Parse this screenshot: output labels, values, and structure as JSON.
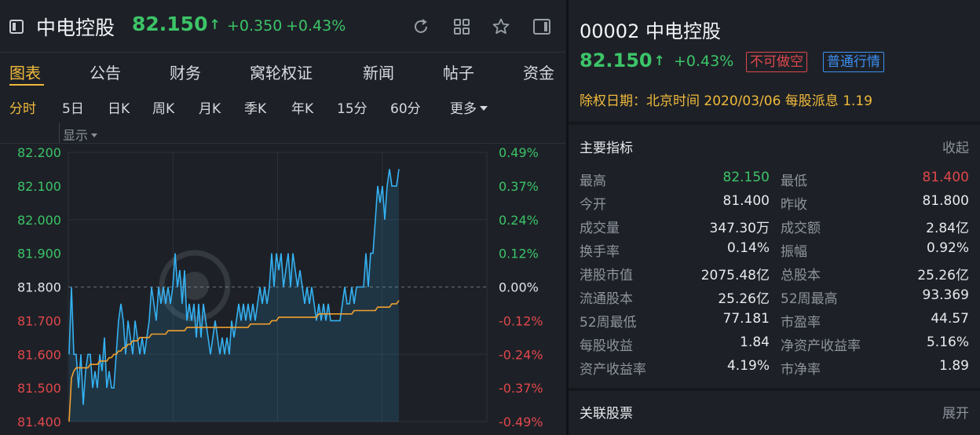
{
  "header": {
    "name": "中电控股",
    "price": "82.150",
    "price_arrow": "↑",
    "change": "+0.350",
    "change_pct": "+0.43%",
    "icons": [
      "panel-toggle-icon",
      "refresh-icon",
      "grid-icon",
      "star-icon",
      "sidebar-toggle-icon"
    ]
  },
  "tabs": [
    "图表",
    "公告",
    "财务",
    "窝轮权证",
    "新闻",
    "帖子",
    "资金"
  ],
  "active_tab": "图表",
  "periods": [
    "分时",
    "5日",
    "日K",
    "周K",
    "月K",
    "季K",
    "年K",
    "15分",
    "60分",
    "更多"
  ],
  "active_period": "分时",
  "display_label": "显示",
  "colors": {
    "up": "#3cc468",
    "down": "#e0474c",
    "accent": "#f0b93b",
    "price_line": "#35b1f2",
    "avg_line": "#f0a030",
    "badge_blue": "#3d8ef0"
  },
  "chart_data": {
    "type": "line",
    "prev_close": 81.8,
    "ylim": [
      81.4,
      82.2
    ],
    "y_ticks": [
      "82.200",
      "82.100",
      "82.000",
      "81.900",
      "81.800",
      "81.700",
      "81.600",
      "81.500",
      "81.400"
    ],
    "pct_ticks": [
      "0.49%",
      "0.37%",
      "0.24%",
      "0.12%",
      "0.00%",
      "-0.12%",
      "-0.24%",
      "-0.37%",
      "-0.49%"
    ],
    "series": [
      {
        "values": [
          81.6,
          81.8,
          81.6,
          81.6,
          81.5,
          81.6,
          81.45,
          81.55,
          81.6,
          81.6,
          81.5,
          81.55,
          81.5,
          81.6,
          81.55,
          81.65,
          81.5,
          81.55,
          81.5,
          81.5,
          81.6,
          81.7,
          81.75,
          81.7,
          81.6,
          81.7,
          81.65,
          81.6,
          81.7,
          81.65,
          81.6,
          81.65,
          81.6,
          81.65,
          81.7,
          81.8,
          81.75,
          81.7,
          81.8,
          81.75,
          81.8,
          81.75,
          81.8,
          81.75,
          81.8,
          81.9,
          81.8,
          81.85,
          81.75,
          81.85,
          81.7,
          81.75,
          81.7,
          81.75,
          81.65,
          81.75,
          81.65,
          81.75,
          81.7,
          81.65,
          81.6,
          81.65,
          81.7,
          81.65,
          81.6,
          81.65,
          81.6,
          81.65,
          81.6,
          81.7,
          81.65,
          81.7,
          81.75,
          81.7,
          81.75,
          81.7,
          81.75,
          81.7,
          81.75,
          81.7,
          81.75,
          81.8,
          81.75,
          81.8,
          81.75,
          81.8,
          81.9,
          81.8,
          81.9,
          81.85,
          81.9,
          81.8,
          81.85,
          81.9,
          81.8,
          81.9,
          81.85,
          81.8,
          81.85,
          81.8,
          81.75,
          81.8,
          81.75,
          81.8,
          81.75,
          81.7,
          81.75,
          81.7,
          81.75,
          81.7,
          81.75,
          81.7,
          81.7,
          81.7,
          81.7,
          81.7,
          81.75,
          81.8,
          81.75,
          81.75,
          81.8,
          81.75,
          81.8,
          81.8,
          81.8,
          81.8,
          81.9,
          81.8,
          81.9,
          81.9,
          82.0,
          82.1,
          82.05,
          82.1,
          82.0,
          82.1,
          82.15,
          82.1,
          82.1,
          82.1,
          82.15
        ]
      },
      {
        "values": [
          81.4,
          81.53,
          81.55,
          81.56,
          81.56,
          81.56,
          81.56,
          81.56,
          81.56,
          81.57,
          81.57,
          81.57,
          81.57,
          81.58,
          81.58,
          81.58,
          81.58,
          81.59,
          81.59,
          81.6,
          81.6,
          81.61,
          81.61,
          81.62,
          81.62,
          81.63,
          81.63,
          81.64,
          81.64,
          81.64,
          81.65,
          81.65,
          81.65,
          81.65,
          81.65,
          81.66,
          81.66,
          81.66,
          81.66,
          81.66,
          81.66,
          81.66,
          81.67,
          81.67,
          81.67,
          81.67,
          81.67,
          81.67,
          81.67,
          81.67,
          81.68,
          81.68,
          81.68,
          81.68,
          81.68,
          81.68,
          81.68,
          81.68,
          81.68,
          81.68,
          81.68,
          81.68,
          81.68,
          81.68,
          81.68,
          81.68,
          81.68,
          81.68,
          81.68,
          81.68,
          81.68,
          81.68,
          81.68,
          81.68,
          81.68,
          81.68,
          81.68,
          81.69,
          81.69,
          81.69,
          81.69,
          81.69,
          81.69,
          81.69,
          81.69,
          81.69,
          81.7,
          81.7,
          81.7,
          81.71,
          81.71,
          81.71,
          81.71,
          81.71,
          81.71,
          81.71,
          81.71,
          81.71,
          81.71,
          81.71,
          81.71,
          81.71,
          81.71,
          81.71,
          81.71,
          81.71,
          81.72,
          81.72,
          81.72,
          81.72,
          81.72,
          81.72,
          81.72,
          81.72,
          81.72,
          81.72,
          81.72,
          81.72,
          81.72,
          81.72,
          81.72,
          81.73,
          81.73,
          81.73,
          81.73,
          81.73,
          81.73,
          81.73,
          81.73,
          81.73,
          81.73,
          81.74,
          81.74,
          81.74,
          81.74,
          81.74,
          81.74,
          81.75,
          81.75,
          81.75,
          81.76
        ]
      }
    ],
    "grid": true
  },
  "quote": {
    "code": "00002",
    "name": "中电控股",
    "price": "82.150",
    "price_arrow": "↑",
    "change_pct": "+0.43%",
    "badge_short": "不可做空",
    "badge_quote": "普通行情",
    "ex_dividend": "除权日期：北京时间 2020/03/06 每股派息 1.19"
  },
  "indicators": {
    "title": "主要指标",
    "collapse_label": "收起",
    "rows": [
      {
        "l1": "最高",
        "v1": "82.150",
        "l2": "最低",
        "v2": "81.400"
      },
      {
        "l1": "今开",
        "v1": "81.400",
        "l2": "昨收",
        "v2": "81.800"
      },
      {
        "l1": "成交量",
        "v1": "347.30万",
        "l2": "成交额",
        "v2": "2.84亿"
      },
      {
        "l1": "换手率",
        "v1": "0.14%",
        "l2": "振幅",
        "v2": "0.92%"
      },
      {
        "l1": "港股市值",
        "v1": "2075.48亿",
        "l2": "总股本",
        "v2": "25.26亿"
      },
      {
        "l1": "流通股本",
        "v1": "25.26亿",
        "l2": "52周最高",
        "v2": "93.369"
      },
      {
        "l1": "52周最低",
        "v1": "77.181",
        "l2": "市盈率",
        "v2": "44.57"
      },
      {
        "l1": "每股收益",
        "v1": "1.84",
        "l2": "净资产收益率",
        "v2": "5.16%"
      },
      {
        "l1": "资产收益率",
        "v1": "4.19%",
        "l2": "市净率",
        "v2": "1.89"
      }
    ]
  },
  "related": {
    "title": "关联股票",
    "expand_label": "展开"
  }
}
